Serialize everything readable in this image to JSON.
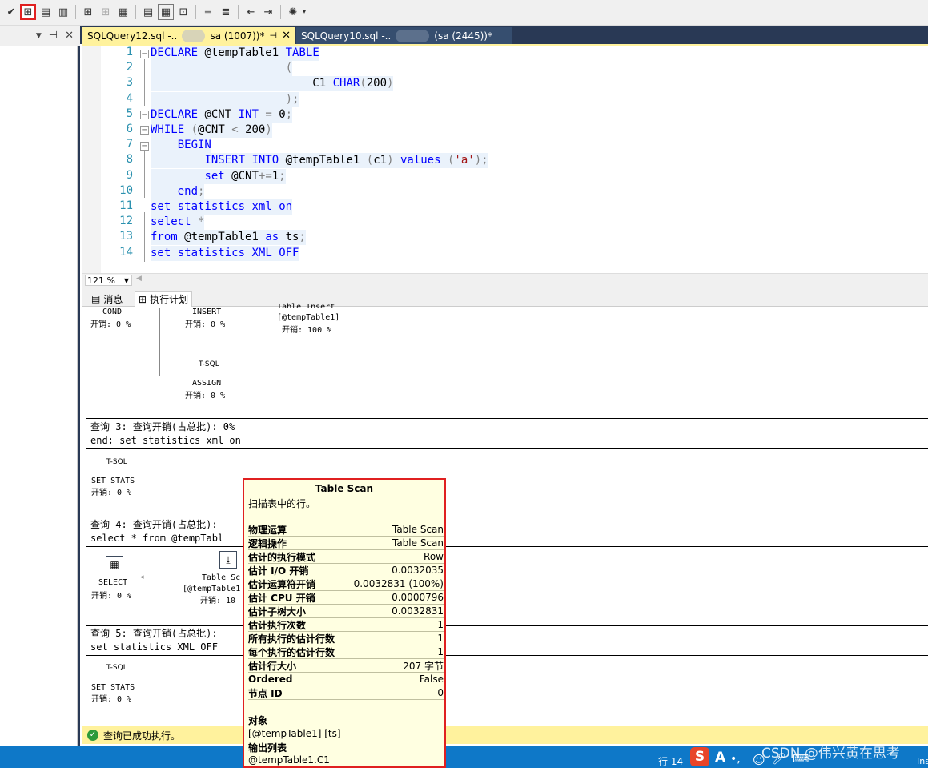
{
  "tabs": [
    {
      "file": "SQLQuery12.sql -..",
      "conn": "sa (1007))*",
      "pin": "⊣",
      "close": "✕"
    },
    {
      "file": "SQLQuery10.sql -..",
      "conn": "(sa (2445))*"
    }
  ],
  "left_panel": {
    "dropdown": "▼",
    "pin": "⊣",
    "close": "✕"
  },
  "editor": {
    "line_numbers": [
      "1",
      "2",
      "3",
      "4",
      "5",
      "6",
      "7",
      "8",
      "9",
      "10",
      "11",
      "12",
      "13",
      "14"
    ],
    "lines": [
      "DECLARE @tempTable1 TABLE",
      "                    (",
      "                        C1 CHAR(200)",
      "                    );",
      "DECLARE @CNT INT = 0;",
      "WHILE (@CNT < 200)",
      "    BEGIN",
      "        INSERT INTO @tempTable1 (c1) values ('a');",
      "        set @CNT+=1;",
      "    end;",
      "set statistics xml on",
      "select *",
      "from @tempTable1 as ts;",
      "set statistics XML OFF"
    ]
  },
  "zoom": "121 %",
  "result_tabs": {
    "messages": "消息",
    "plan": "执行计划"
  },
  "plan": {
    "q2": {
      "cond_name": "COND",
      "cond_cost": "开销: 0 %",
      "insert_name": "INSERT",
      "insert_cost": "开销: 0 %",
      "table_insert_name": "Table Insert",
      "table_insert_obj": "[@tempTable1]",
      "table_insert_cost": "开销: 100 %",
      "tsql_label": "T-SQL",
      "assign_name": "ASSIGN",
      "assign_cost": "开销: 0 %"
    },
    "q3": {
      "header": "查询 3: 查询开销(占总批): 0%",
      "stmt": "end; set statistics xml on",
      "tsql_label": "T-SQL",
      "op": "SET STATS",
      "cost": "开销: 0 %"
    },
    "q4": {
      "header": "查询 4: 查询开销(占总批):",
      "stmt": "select * from @tempTabl",
      "select_name": "SELECT",
      "select_cost": "开销: 0 %",
      "scan_name": "Table Sc",
      "scan_obj": "[@tempTable1",
      "scan_cost": "开销: 10"
    },
    "q5": {
      "header": "查询 5: 查询开销(占总批):",
      "stmt": "set statistics XML OFF",
      "tsql_label": "T-SQL",
      "op": "SET STATS",
      "cost": "开销: 0 %"
    }
  },
  "tooltip": {
    "title": "Table Scan",
    "desc": "扫描表中的行。",
    "rows": [
      {
        "k": "物理运算",
        "v": "Table Scan"
      },
      {
        "k": "逻辑操作",
        "v": "Table Scan"
      },
      {
        "k": "估计的执行模式",
        "v": "Row"
      },
      {
        "k": "估计 I/O 开销",
        "v": "0.0032035"
      },
      {
        "k": "估计运算符开销",
        "v": "0.0032831 (100%)"
      },
      {
        "k": "估计 CPU 开销",
        "v": "0.0000796"
      },
      {
        "k": "估计子树大小",
        "v": "0.0032831"
      },
      {
        "k": "估计执行次数",
        "v": "1"
      },
      {
        "k": "所有执行的估计行数",
        "v": "1"
      },
      {
        "k": "每个执行的估计行数",
        "v": "1"
      },
      {
        "k": "估计行大小",
        "v": "207 字节"
      },
      {
        "k": "Ordered",
        "v": "False"
      },
      {
        "k": "节点 ID",
        "v": "0"
      }
    ],
    "object_label": "对象",
    "object_value": "[@tempTable1] [ts]",
    "output_label": "输出列表",
    "output_value": "@tempTable1.C1"
  },
  "status": {
    "message": "查询已成功执行。",
    "row": "行 14",
    "ime_letter": "A",
    "ime_tail": "Ins"
  },
  "watermark": "CSDN @伟兴黄在思考"
}
